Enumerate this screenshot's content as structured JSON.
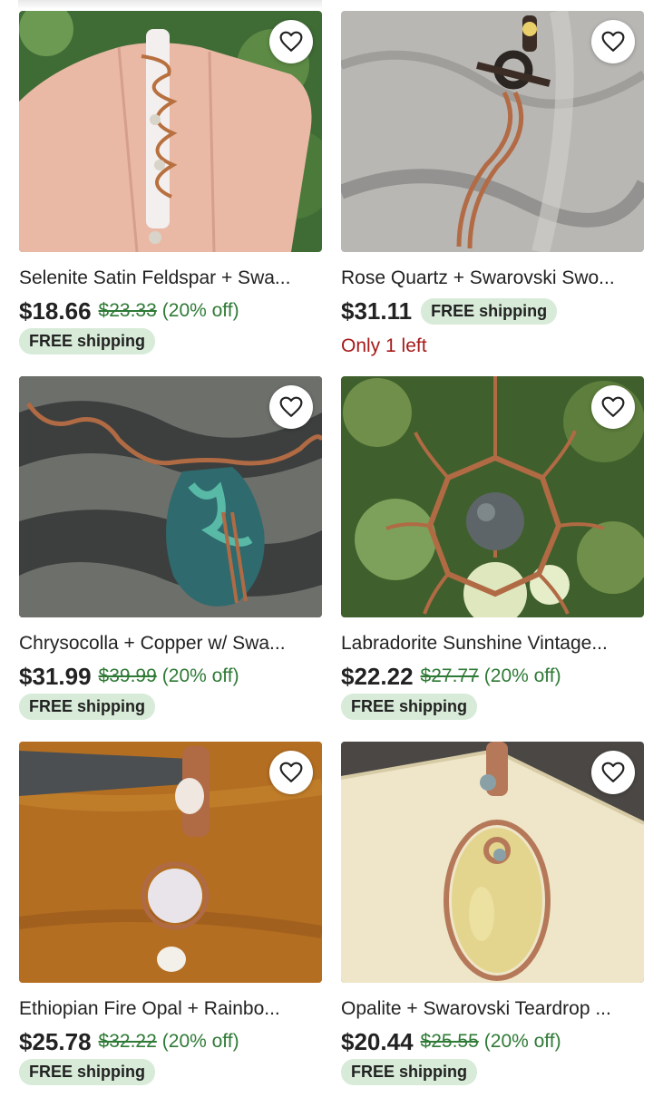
{
  "listings": [
    {
      "title": "Selenite Satin Feldspar + Swa...",
      "price": "$18.66",
      "original_price": "$23.33",
      "discount": "(20% off)",
      "shipping": "FREE shipping",
      "image_desc": "Selenite wire-wrapped pendant in hand"
    },
    {
      "title": "Rose Quartz + Swarovski Swo...",
      "price": "$31.11",
      "shipping": "FREE shipping",
      "stock": "Only 1 left",
      "image_desc": "Copper wire sword pendant on marble"
    },
    {
      "title": "Chrysocolla + Copper w/ Swa...",
      "price": "$31.99",
      "original_price": "$39.99",
      "discount": "(20% off)",
      "shipping": "FREE shipping",
      "image_desc": "Chrysocolla pendant on tattooed arm"
    },
    {
      "title": "Labradorite Sunshine Vintage...",
      "price": "$22.22",
      "original_price": "$27.77",
      "discount": "(20% off)",
      "shipping": "FREE shipping",
      "image_desc": "Labradorite sun wire pendant on leaves"
    },
    {
      "title": "Ethiopian Fire Opal + Rainbo...",
      "price": "$25.78",
      "original_price": "$32.22",
      "discount": "(20% off)",
      "shipping": "FREE shipping",
      "image_desc": "Opal and moonstone pendant on wood"
    },
    {
      "title": "Opalite + Swarovski Teardrop ...",
      "price": "$20.44",
      "original_price": "$25.55",
      "discount": "(20% off)",
      "shipping": "FREE shipping",
      "image_desc": "Opalite teardrop pendant on cream dish"
    }
  ],
  "colors": {
    "discount_green": "#2f7a36",
    "badge_bg": "#d7ebd8",
    "stock_red": "#a61a1a",
    "text": "#222222"
  }
}
